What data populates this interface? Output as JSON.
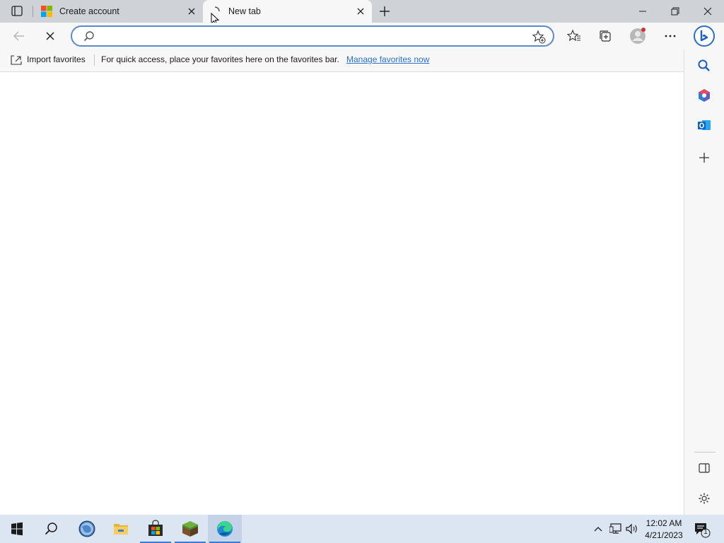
{
  "tabs": [
    {
      "label": "Create account",
      "active": false
    },
    {
      "label": "New tab",
      "active": true
    }
  ],
  "address": {
    "value": "",
    "placeholder": ""
  },
  "favorites_bar": {
    "import_label": "Import favorites",
    "message": "For quick access, place your favorites here on the favorites bar.",
    "manage_link": "Manage favorites now"
  },
  "taskbar": {
    "time": "12:02 AM",
    "date": "4/21/2023",
    "notification_count": "1"
  },
  "colors": {
    "accent": "#2a6fc9",
    "titlebar": "#cfd3d8",
    "toolbar": "#f7f7f7",
    "taskbar": "#dce6f3"
  }
}
